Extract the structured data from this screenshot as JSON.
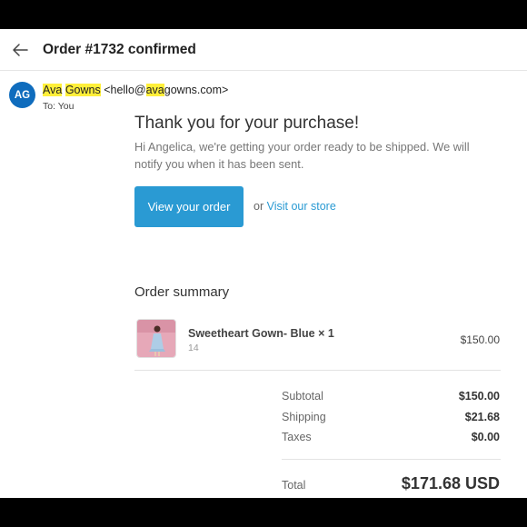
{
  "header": {
    "subject": "Order #1732 confirmed"
  },
  "sender": {
    "initials": "AG",
    "name_part1": "Ava",
    "name_part2": "Gowns",
    "email_prefix": "<hello@",
    "email_highlight": "ava",
    "email_suffix": "gowns.com>",
    "to_label": "To:",
    "to_value": "You"
  },
  "body": {
    "heading": "Thank you for your purchase!",
    "message": "Hi Angelica, we're getting your order ready to be shipped. We will notify you when it has been sent.",
    "view_order_label": "View your order",
    "or_text": "or",
    "visit_store_label": "Visit our store"
  },
  "summary": {
    "heading": "Order summary",
    "item": {
      "name": "Sweetheart Gown- Blue × 1",
      "variant": "14",
      "price": "$150.00"
    },
    "subtotal_label": "Subtotal",
    "subtotal_value": "$150.00",
    "shipping_label": "Shipping",
    "shipping_value": "$21.68",
    "taxes_label": "Taxes",
    "taxes_value": "$0.00",
    "total_label": "Total",
    "total_value": "$171.68 USD"
  },
  "colors": {
    "accent": "#2a9ad3",
    "avatar": "#0f6cbd",
    "highlight": "#ffef3a"
  }
}
